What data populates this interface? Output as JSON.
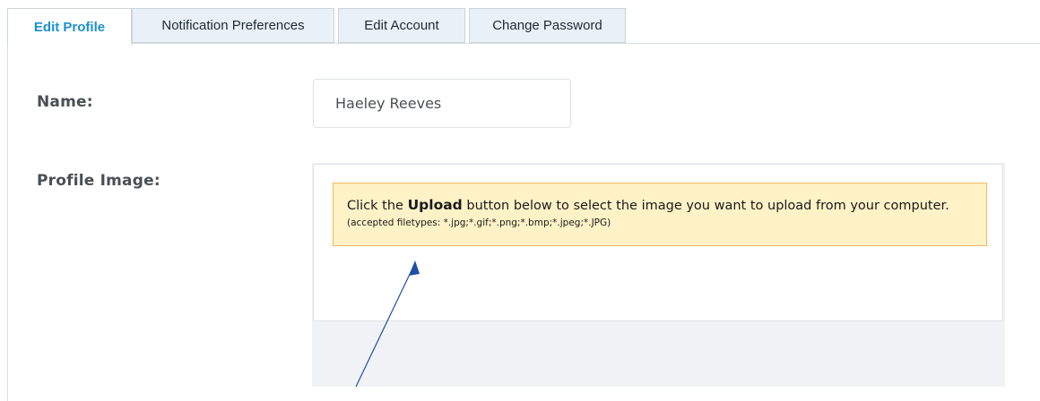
{
  "tabs": [
    {
      "label": "Edit Profile",
      "active": true
    },
    {
      "label": "Notification Preferences",
      "active": false
    },
    {
      "label": "Edit Account",
      "active": false
    },
    {
      "label": "Change Password",
      "active": false
    }
  ],
  "form": {
    "name_label": "Name:",
    "name_value": "Haeley Reeves",
    "image_label": "Profile Image:"
  },
  "upload": {
    "instruction_prefix": "Click the",
    "instruction_bold": "Upload",
    "instruction_suffix": "button below to select the image you want to upload from your computer.",
    "filetypes": "(accepted filetypes: *.jpg;*.gif;*.png;*.bmp;*.jpeg;*.JPG)"
  },
  "colors": {
    "active_tab_text": "#1a8fd0",
    "notice_background": "#fff2c7",
    "notice_border": "#f0b860",
    "arrow": "#1f4fa8"
  }
}
